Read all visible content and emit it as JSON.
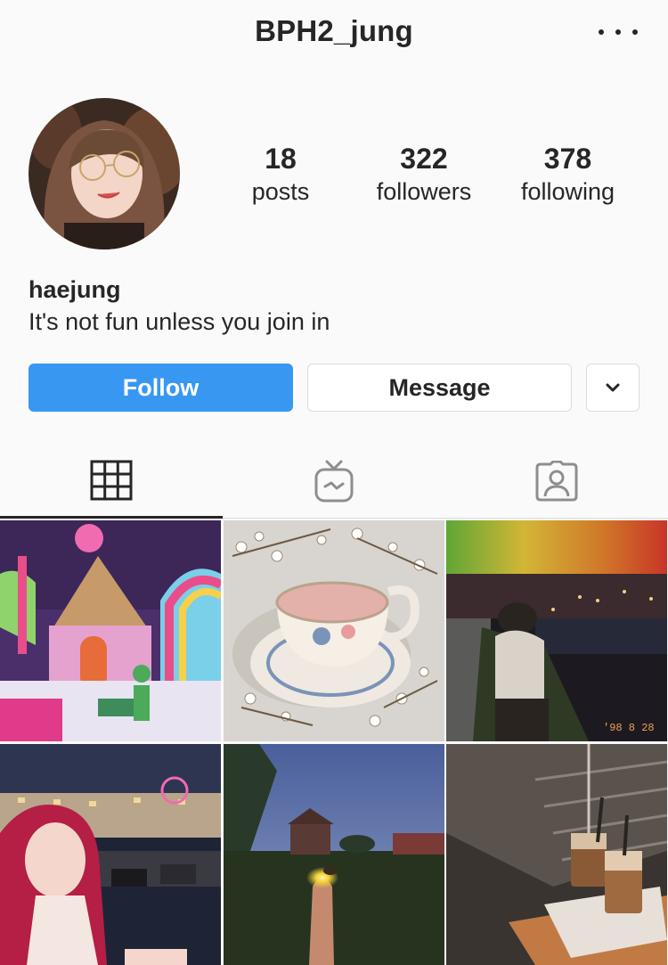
{
  "header": {
    "username": "BPH2_jung",
    "more_icon": "more-horizontal-icon"
  },
  "profile": {
    "avatar_icon": "profile-photo",
    "stats": {
      "posts_count": "18",
      "posts_label": "posts",
      "followers_count": "322",
      "followers_label": "followers",
      "following_count": "378",
      "following_label": "following"
    },
    "full_name": "haejung",
    "bio": "It's not fun unless you join in"
  },
  "actions": {
    "follow_label": "Follow",
    "message_label": "Message",
    "dropdown_icon": "chevron-down-icon"
  },
  "tabs": [
    {
      "name": "grid",
      "icon": "grid-icon",
      "active": true
    },
    {
      "name": "igtv",
      "icon": "igtv-icon",
      "active": false
    },
    {
      "name": "tagged",
      "icon": "tagged-person-icon",
      "active": false
    }
  ],
  "photo_stamp": "'98 8 28",
  "colors": {
    "accent": "#3897f0",
    "text": "#262626",
    "border": "#dbdbdb",
    "background": "#fafafa"
  }
}
